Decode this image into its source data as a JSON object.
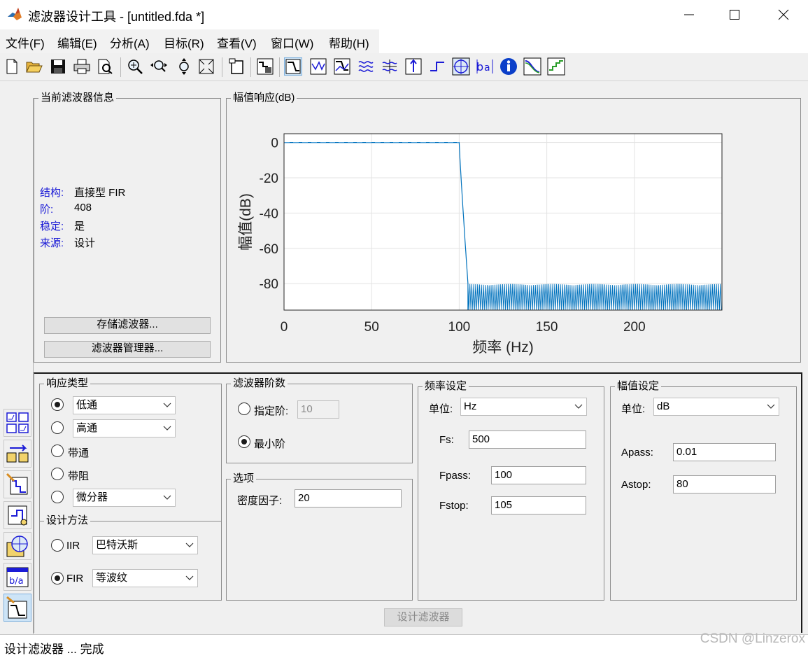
{
  "window": {
    "title": "滤波器设计工具 -  [untitled.fda *]",
    "controls": {
      "minimize": "minimize-icon",
      "maximize": "maximize-icon",
      "close": "close-icon"
    }
  },
  "menu": [
    "文件(F)",
    "编辑(E)",
    "分析(A)",
    "目标(R)",
    "查看(V)",
    "窗口(W)",
    "帮助(H)"
  ],
  "toolbar": {
    "file_icons": [
      "new-file-icon",
      "open-folder-icon",
      "save-icon",
      "print-icon",
      "print-preview-icon"
    ],
    "zoom_icons": [
      "zoom-in-icon",
      "zoom-x-icon",
      "zoom-y-icon",
      "full-view-icon"
    ],
    "analysis_icons": [
      "magnitude-response-icon",
      "phase-response-icon",
      "magnitude-phase-icon",
      "group-delay-icon",
      "phase-delay-icon",
      "impulse-response-icon",
      "step-response-icon",
      "pole-zero-icon",
      "filter-coefficients-icon",
      "filter-info-icon",
      "magnitude-estimate-icon",
      "round-off-noise-icon"
    ],
    "active_tool": "magnitude-response-icon"
  },
  "left_tools": [
    "transform-filter-icon",
    "realize-model-icon",
    "import-filter-icon",
    "pole-zero-editor-icon",
    "multirate-icon",
    "quantize-icon",
    "design-filter-icon"
  ],
  "info": {
    "title": "当前滤波器信息",
    "rows": [
      {
        "label": "结构:",
        "value": "直接型 FIR"
      },
      {
        "label": "阶:",
        "value": "408"
      },
      {
        "label": "稳定:",
        "value": "是"
      },
      {
        "label": "来源:",
        "value": "设计"
      }
    ],
    "store_button": "存储滤波器...",
    "manager_button": "滤波器管理器..."
  },
  "plot": {
    "panel_title": "幅值响应(dB)"
  },
  "chart_data": {
    "type": "line",
    "title": "",
    "xlabel": "频率 (Hz)",
    "ylabel": "幅值(dB)",
    "xlim": [
      0,
      250
    ],
    "ylim": [
      -95,
      5
    ],
    "xticks": [
      "0",
      "50",
      "100",
      "150",
      "200"
    ],
    "yticks": [
      "0",
      "-20",
      "-40",
      "-60",
      "-80"
    ],
    "grid": true,
    "series": [
      {
        "description": "dashed reference ideal",
        "style": "dashed",
        "points": [
          [
            0,
            0
          ],
          [
            100,
            0
          ]
        ]
      },
      {
        "style": "solid",
        "passband": {
          "x": [
            0,
            100
          ],
          "y": 0
        },
        "transition": {
          "x": [
            100,
            105
          ],
          "y": [
            0,
            -80
          ]
        },
        "stopband": {
          "x": [
            105,
            250
          ],
          "y_max": -80,
          "y_min": -95
        }
      }
    ]
  },
  "response_type": {
    "title": "响应类型",
    "options": [
      {
        "label": "低通",
        "kind": "select",
        "checked": true
      },
      {
        "label": "高通",
        "kind": "select",
        "checked": false
      },
      {
        "label": "带通",
        "kind": "text",
        "checked": false
      },
      {
        "label": "带阻",
        "kind": "text",
        "checked": false
      },
      {
        "label": "微分器",
        "kind": "select",
        "checked": false
      }
    ]
  },
  "design_method": {
    "title": "设计方法",
    "options": [
      {
        "label": "IIR",
        "value": "巴特沃斯",
        "checked": false
      },
      {
        "label": "FIR",
        "value": "等波纹",
        "checked": true
      }
    ]
  },
  "filter_order": {
    "title": "滤波器阶数",
    "specify_label": "指定阶:",
    "specify_value": "10",
    "specify_checked": false,
    "minimum_label": "最小阶",
    "minimum_checked": true
  },
  "options": {
    "title": "选项",
    "density_label": "密度因子:",
    "density_value": "20"
  },
  "freq_spec": {
    "title": "频率设定",
    "units_label": "单位:",
    "units_value": "Hz",
    "fields": [
      {
        "label": "Fs:",
        "value": "500"
      },
      {
        "label": "Fpass:",
        "value": "100"
      },
      {
        "label": "Fstop:",
        "value": "105"
      }
    ]
  },
  "mag_spec": {
    "title": "幅值设定",
    "units_label": "单位:",
    "units_value": "dB",
    "fields": [
      {
        "label": "Apass:",
        "value": "0.01"
      },
      {
        "label": "Astop:",
        "value": "80"
      }
    ]
  },
  "design_button": "设计滤波器",
  "status": "设计滤波器 ... 完成",
  "watermark": "CSDN @Linzerox",
  "colors": {
    "plot_line": "#0072bd",
    "dashed": "#4d9fd8",
    "info_label": "#1b1bd6",
    "active_tool": "#cde4f7"
  }
}
